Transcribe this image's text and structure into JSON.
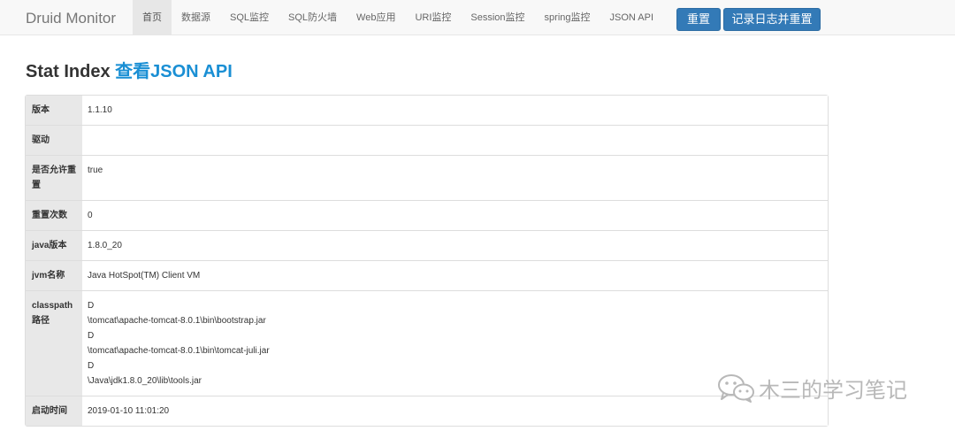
{
  "navbar": {
    "brand": "Druid Monitor",
    "items": [
      {
        "label": "首页",
        "active": true
      },
      {
        "label": "数据源",
        "active": false
      },
      {
        "label": "SQL监控",
        "active": false
      },
      {
        "label": "SQL防火墙",
        "active": false
      },
      {
        "label": "Web应用",
        "active": false
      },
      {
        "label": "URI监控",
        "active": false
      },
      {
        "label": "Session监控",
        "active": false
      },
      {
        "label": "spring监控",
        "active": false
      },
      {
        "label": "JSON API",
        "active": false
      }
    ],
    "reset_label": "重置",
    "log_reset_label": "记录日志并重置"
  },
  "heading": {
    "title": "Stat Index",
    "link": "查看JSON API"
  },
  "stats": [
    {
      "key": "版本",
      "value": [
        "1.1.10"
      ]
    },
    {
      "key": "驱动",
      "value": [
        ""
      ]
    },
    {
      "key": "是否允许重置",
      "value": [
        "true"
      ]
    },
    {
      "key": "重置次数",
      "value": [
        "0"
      ]
    },
    {
      "key": "java版本",
      "value": [
        "1.8.0_20"
      ]
    },
    {
      "key": "jvm名称",
      "value": [
        "Java HotSpot(TM) Client VM"
      ]
    },
    {
      "key": "classpath路径",
      "value": [
        "D",
        "\\tomcat\\apache-tomcat-8.0.1\\bin\\bootstrap.jar",
        "D",
        "\\tomcat\\apache-tomcat-8.0.1\\bin\\tomcat-juli.jar",
        "D",
        "\\Java\\jdk1.8.0_20\\lib\\tools.jar"
      ]
    },
    {
      "key": "启动时间",
      "value": [
        "2019-01-10 11:01:20"
      ]
    }
  ],
  "watermark": {
    "text": "木三的学习笔记",
    "icon": "wechat-icon"
  },
  "colors": {
    "accent": "#337ab7",
    "link": "#1a8fd4",
    "navbar_bg": "#f8f8f8",
    "key_bg": "#e8e8e8"
  }
}
